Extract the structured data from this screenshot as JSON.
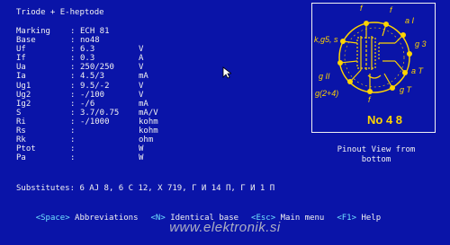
{
  "title": "Triode + E-heptode",
  "params": [
    {
      "label": "Marking",
      "value": "ECH 81",
      "unit": ""
    },
    {
      "label": "Base",
      "value": "no48",
      "unit": ""
    },
    {
      "label": "Uf",
      "value": "6.3",
      "unit": "V"
    },
    {
      "label": "If",
      "value": "0.3",
      "unit": "A"
    },
    {
      "label": "Ua",
      "value": "250/250",
      "unit": "V"
    },
    {
      "label": "Ia",
      "value": "4.5/3",
      "unit": "mA"
    },
    {
      "label": "Ug1",
      "value": "9.5/-2",
      "unit": "V"
    },
    {
      "label": "Ug2",
      "value": "-/100",
      "unit": "V"
    },
    {
      "label": "Ig2",
      "value": "-/6",
      "unit": "mA"
    },
    {
      "label": "S",
      "value": "3.7/0.75",
      "unit": "mA/V"
    },
    {
      "label": "Ri",
      "value": "-/1000",
      "unit": "kohm"
    },
    {
      "label": "Rs",
      "value": "",
      "unit": "kohm"
    },
    {
      "label": "Rk",
      "value": "",
      "unit": "ohm"
    },
    {
      "label": "Ptot",
      "value": "",
      "unit": "W"
    },
    {
      "label": "Pa",
      "value": "",
      "unit": "W"
    }
  ],
  "separator": ":",
  "diagram": {
    "base_label": "No 4 8",
    "pins": [
      "f",
      "f",
      "a I",
      "g 3",
      "a T",
      "g T",
      "f",
      "g(2+4)",
      "g II",
      "k,g5, s"
    ]
  },
  "pinout_caption": "Pinout View from\nbottom",
  "substitutes": "Substitutes: 6 AJ 8, 6 C 12, X 719, Г И 14 П, Г И 1 П",
  "footer": [
    {
      "key": "<Space>",
      "desc": "Abbreviations"
    },
    {
      "key": "<N>",
      "desc": "Identical base"
    },
    {
      "key": "<Esc>",
      "desc": "Main menu"
    },
    {
      "key": "<F1>",
      "desc": "Help"
    }
  ],
  "watermark": "www.elektronik.si",
  "colors": {
    "background": "#0a14a8",
    "text": "#f2f2f2",
    "accent": "#ffd400",
    "key": "#6ee0ff"
  }
}
